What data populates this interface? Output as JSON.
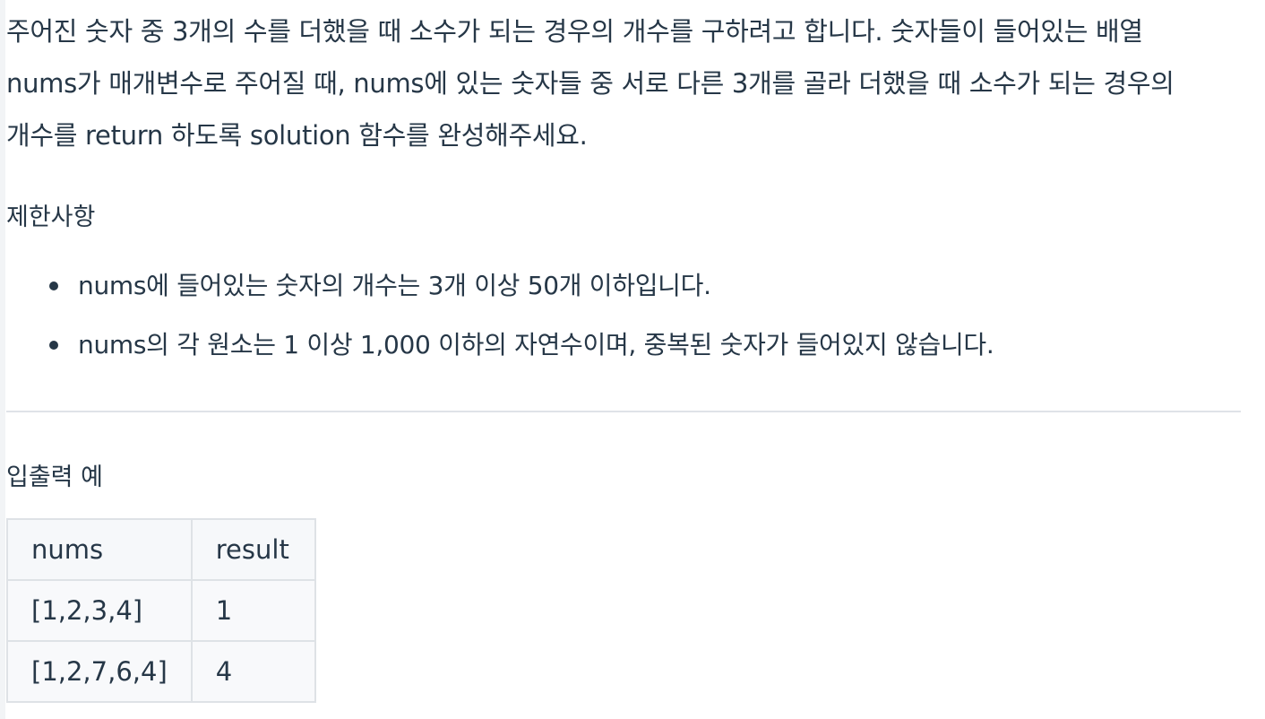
{
  "description": {
    "text": "주어진 숫자 중 3개의 수를 더했을 때 소수가 되는 경우의 개수를 구하려고 합니다. 숫자들이 들어있는 배열 nums가 매개변수로 주어질 때, nums에 있는 숫자들 중 서로 다른 3개를 골라 더했을 때 소수가 되는 경우의 개수를 return 하도록 solution 함수를 완성해주세요."
  },
  "constraints": {
    "title": "제한사항",
    "items": [
      "nums에 들어있는 숫자의 개수는 3개 이상 50개 이하입니다.",
      "nums의 각 원소는 1 이상 1,000 이하의 자연수이며, 중복된 숫자가 들어있지 않습니다."
    ]
  },
  "examples": {
    "title": "입출력 예",
    "headers": [
      "nums",
      "result"
    ],
    "rows": [
      [
        "[1,2,3,4]",
        "1"
      ],
      [
        "[1,2,7,6,4]",
        "4"
      ]
    ]
  }
}
